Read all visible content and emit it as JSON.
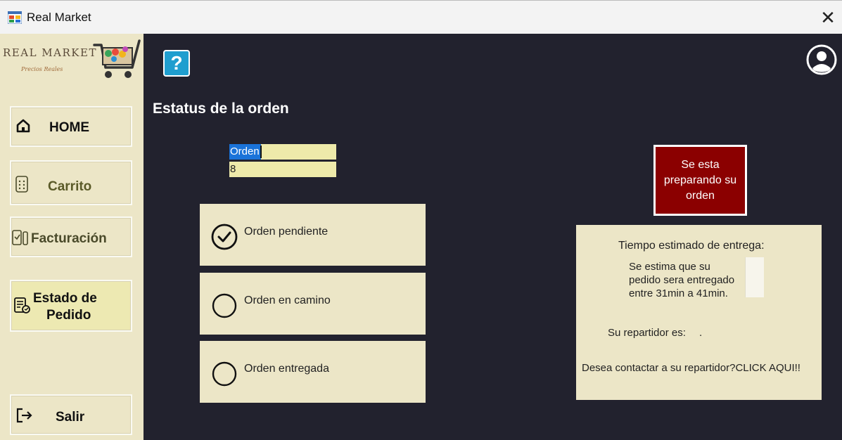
{
  "window": {
    "title": "Real Market",
    "close_symbol": "✕"
  },
  "logo": {
    "brand": "REAL MARKET",
    "slogan": "Precios Reales"
  },
  "sidebar": {
    "items": [
      {
        "label": "HOME",
        "icon": "home-icon"
      },
      {
        "label": "Carrito",
        "icon": "calculator-icon",
        "color": "#5a5a28"
      },
      {
        "label": "Facturación",
        "icon": "clipboard-icon",
        "color": "#4a4a2a"
      },
      {
        "label": "Estado de Pedido",
        "label_line1": "Estado de",
        "label_line2": "Pedido",
        "icon": "order-status-icon",
        "active": true
      },
      {
        "label": "Salir",
        "icon": "logout-icon"
      }
    ]
  },
  "header": {
    "help_symbol": "?",
    "help_icon": "help-icon",
    "user_icon": "user-icon",
    "page_title": "Estatus de la orden"
  },
  "order": {
    "label": "Orden",
    "number": "8"
  },
  "statuses": [
    {
      "label": "Orden pendiente",
      "checked": true
    },
    {
      "label": "Orden en camino",
      "checked": false
    },
    {
      "label": "Orden entregada",
      "checked": false
    }
  ],
  "current_status": {
    "line1": "Se esta",
    "line2": "preparando su",
    "line3": "orden"
  },
  "delivery": {
    "title": "Tiempo estimado de entrega:",
    "estimate_line1": "Se estima que su",
    "estimate_line2": "pedido sera entregado",
    "estimate_line3": "entre 31min a 41min.",
    "courier_label": "Su repartidor es:",
    "courier_value": ".",
    "contact": "Desea contactar a su repartidor?CLICK AQUI!!"
  },
  "colors": {
    "sidebar_bg": "#ece6c7",
    "main_bg": "#22222e",
    "status_button_bg": "#8b0000",
    "help_button_bg": "#1f9ecf",
    "selection_bg": "#1a73d9"
  }
}
